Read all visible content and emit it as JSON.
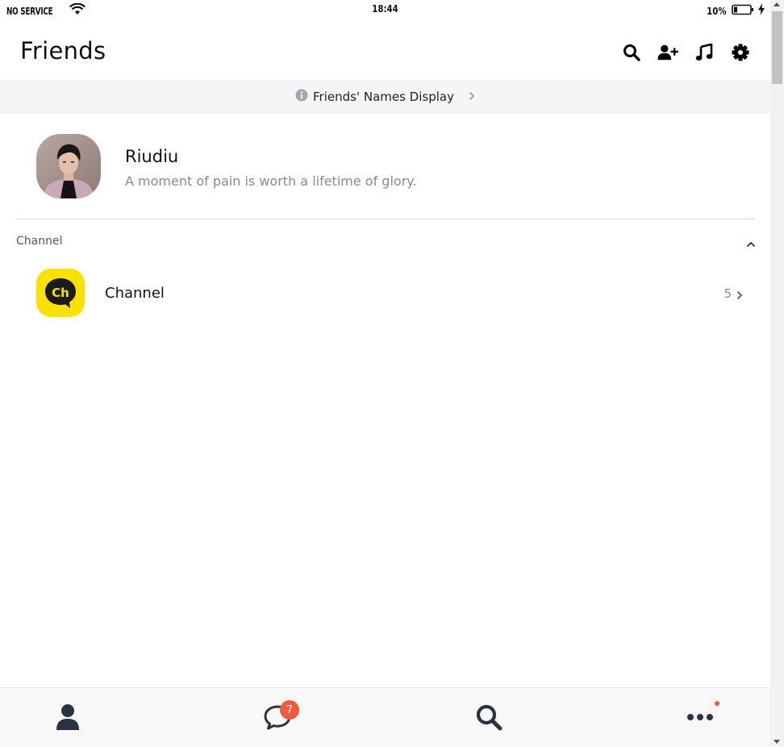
{
  "status_bar": {
    "carrier": "NO SERVICE",
    "time": "18:44",
    "battery": "10%",
    "icons": [
      "wifi-icon",
      "battery-icon",
      "charging-bolt-icon"
    ]
  },
  "header": {
    "title": "Friends",
    "actions": [
      "search-icon",
      "add-friend-icon",
      "music-icon",
      "settings-icon"
    ]
  },
  "banner": {
    "icon": "info-icon",
    "text": "Friends' Names Display"
  },
  "profile": {
    "name": "Riudiu",
    "status_message": "A moment of pain is worth a lifetime of glory."
  },
  "section": {
    "label": "Channel",
    "expanded": true
  },
  "channel": {
    "icon_text": "Ch",
    "name": "Channel",
    "count": "5"
  },
  "tab_bar": {
    "tabs": [
      "friends-tab",
      "chats-tab",
      "search-tab",
      "more-tab"
    ],
    "chats_badge": "7"
  },
  "colors": {
    "accent_badge": "#f15a3a",
    "channel_yellow": "#fae100",
    "banner_bg": "#f4f5f7",
    "icon_dark": "#2b3340"
  }
}
